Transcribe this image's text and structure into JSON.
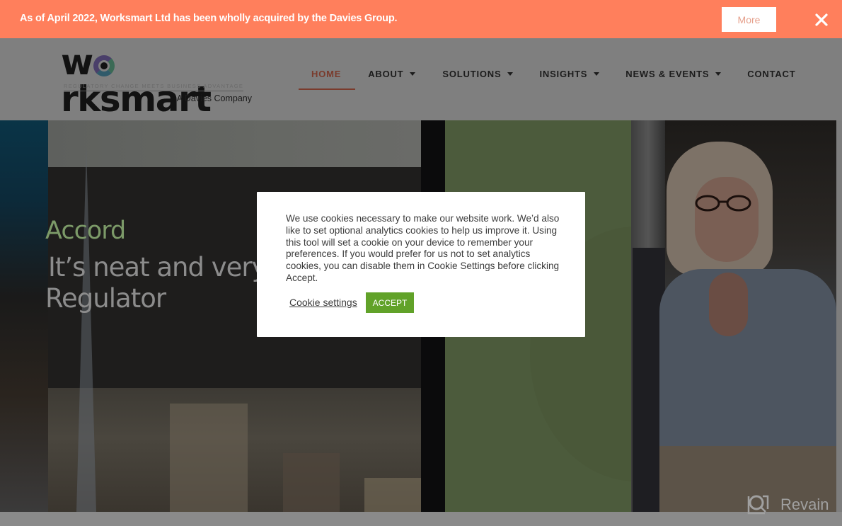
{
  "announcement": {
    "text": "As of April 2022, Worksmart Ltd has been wholly acquired by the Davies Group.",
    "more_label": "More",
    "close_icon": "close-icon",
    "background_color": "#ff7f5c"
  },
  "header": {
    "logo": {
      "word_prefix": "w",
      "word_suffix": "rksmart",
      "tagline": "REGULATORY CHANGE MEETS BUSINESS ADVANTAGE",
      "subtitle": "A Davies Company"
    },
    "nav": [
      {
        "label": "HOME",
        "active": true,
        "has_dropdown": false
      },
      {
        "label": "ABOUT",
        "active": false,
        "has_dropdown": true
      },
      {
        "label": "SOLUTIONS",
        "active": false,
        "has_dropdown": true
      },
      {
        "label": "INSIGHTS",
        "active": false,
        "has_dropdown": true
      },
      {
        "label": "NEWS & EVENTS",
        "active": false,
        "has_dropdown": true
      },
      {
        "label": "CONTACT",
        "active": false,
        "has_dropdown": false
      }
    ]
  },
  "hero": {
    "title": "Accord",
    "lines": [
      "It’s neat and very",
      "Regulator"
    ],
    "accent_color": "#7c9a68"
  },
  "cookie_banner": {
    "message": "We use cookies necessary to make our website work. We’d also like to set optional analytics cookies to help us improve it. Using this tool will set a cookie on your device to remember your preferences. If you would prefer for us not to set analytics cookies, you can disable them in Cookie Settings before clicking Accept.",
    "settings_label": "Cookie settings",
    "accept_label": "ACCEPT",
    "accept_color": "#61a229"
  },
  "watermark": {
    "text": "Revain",
    "icon": "revain-logo-icon"
  }
}
